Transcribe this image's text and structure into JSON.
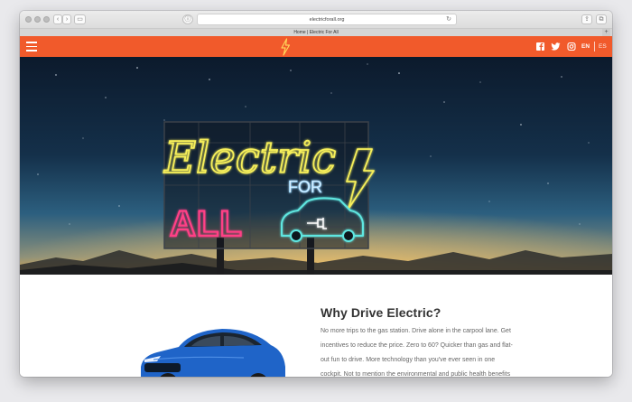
{
  "browser": {
    "url": "electricforall.org",
    "tab_title": "Home | Electric For All"
  },
  "header": {
    "brand_color": "#f15a2b",
    "social": [
      "facebook-icon",
      "twitter-icon",
      "instagram-icon"
    ],
    "languages": [
      "EN",
      "ES"
    ]
  },
  "hero": {
    "sign": {
      "script": "Electric",
      "for": "FOR",
      "all": "ALL"
    }
  },
  "section": {
    "title": "Why Drive Electric?",
    "body": "No more trips to the gas station. Drive alone in the carpool lane. Get incentives to reduce the price. Zero to 60? Quicker than gas and flat-out fun to drive. More technology than you've ever seen in one cockpit. Not to mention the environmental and public health benefits of going electric."
  }
}
